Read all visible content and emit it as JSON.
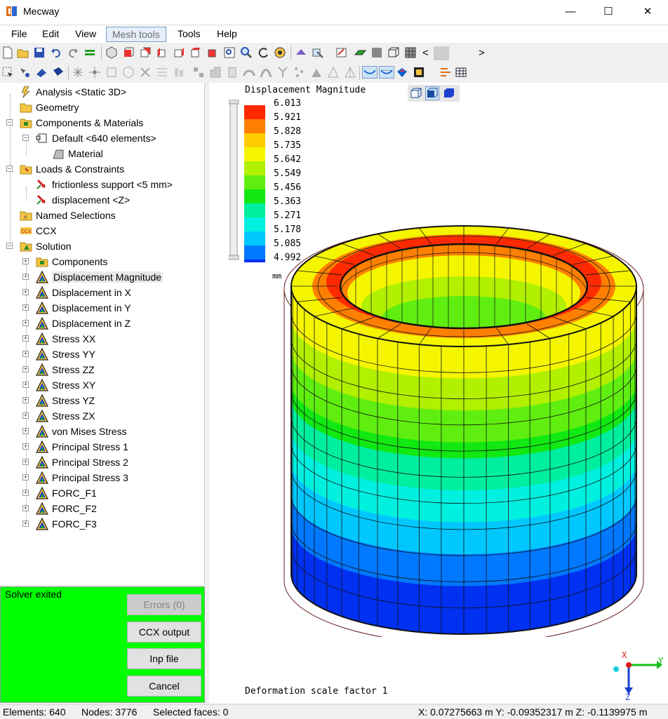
{
  "window": {
    "title": "Mecway",
    "minimize": "—",
    "maximize": "☐",
    "close": "✕"
  },
  "menu": [
    "File",
    "Edit",
    "View",
    "Mesh tools",
    "Tools",
    "Help"
  ],
  "toolbar": {
    "scroll_left": "<",
    "scroll_right": ">"
  },
  "tree": [
    {
      "label": "Analysis <Static 3D>",
      "icon": "lightning-icon"
    },
    {
      "label": "Geometry",
      "icon": "folder-icon"
    },
    {
      "label": "Components & Materials",
      "icon": "components-icon"
    },
    {
      "label": "Default <640 elements>",
      "icon": "component-icon"
    },
    {
      "label": "Material",
      "icon": "material-icon"
    },
    {
      "label": "Loads & Constraints",
      "icon": "loads-folder-icon"
    },
    {
      "label": "frictionless support <5 mm>",
      "icon": "constraint-icon"
    },
    {
      "label": "displacement <Z>",
      "icon": "constraint-icon"
    },
    {
      "label": "Named Selections",
      "icon": "named-selections-icon"
    },
    {
      "label": "CCX",
      "icon": "ccx-icon"
    },
    {
      "label": "Solution",
      "icon": "solution-icon"
    },
    {
      "label": "Components",
      "icon": "components-icon"
    },
    {
      "label": "Displacement Magnitude",
      "icon": "result-icon"
    },
    {
      "label": "Displacement in X",
      "icon": "result-icon"
    },
    {
      "label": "Displacement in Y",
      "icon": "result-icon"
    },
    {
      "label": "Displacement in Z",
      "icon": "result-icon"
    },
    {
      "label": "Stress XX",
      "icon": "result-icon"
    },
    {
      "label": "Stress YY",
      "icon": "result-icon"
    },
    {
      "label": "Stress ZZ",
      "icon": "result-icon"
    },
    {
      "label": "Stress XY",
      "icon": "result-icon"
    },
    {
      "label": "Stress YZ",
      "icon": "result-icon"
    },
    {
      "label": "Stress ZX",
      "icon": "result-icon"
    },
    {
      "label": "von Mises Stress",
      "icon": "result-icon"
    },
    {
      "label": "Principal Stress 1",
      "icon": "result-icon"
    },
    {
      "label": "Principal Stress 2",
      "icon": "result-icon"
    },
    {
      "label": "Principal Stress 3",
      "icon": "result-icon"
    },
    {
      "label": "FORC_F1",
      "icon": "result-icon"
    },
    {
      "label": "FORC_F2",
      "icon": "result-icon"
    },
    {
      "label": "FORC_F3",
      "icon": "result-icon"
    }
  ],
  "solver": {
    "status": "Solver exited",
    "errors_button": "Errors (0)",
    "ccx_output_button": "CCX output",
    "inp_file_button": "Inp file",
    "cancel_button": "Cancel",
    "panel_color": "#00ff00"
  },
  "viewport": {
    "plot_title": "Displacement Magnitude",
    "legend_values": [
      "6.013",
      "5.921",
      "5.828",
      "5.735",
      "5.642",
      "5.549",
      "5.456",
      "5.363",
      "5.271",
      "5.178",
      "5.085",
      "4.992"
    ],
    "legend_colors": [
      "#ff2a00",
      "#ff8000",
      "#ffcc00",
      "#f5f500",
      "#b0f000",
      "#60ee10",
      "#12e812",
      "#00eea0",
      "#00f0e0",
      "#00c8ff",
      "#0078ff",
      "#0030f0"
    ],
    "unit": "mm",
    "deformation_text": "Deformation scale factor 1",
    "axes": {
      "x": "X",
      "y": "Y",
      "z": "Z"
    }
  },
  "statusbar": {
    "elements": "Elements: 640",
    "nodes": "Nodes: 3776",
    "selected": "Selected faces: 0",
    "coords": "X: 0.07275663 m Y: -0.09352317 m Z: -0.1139975 m"
  }
}
